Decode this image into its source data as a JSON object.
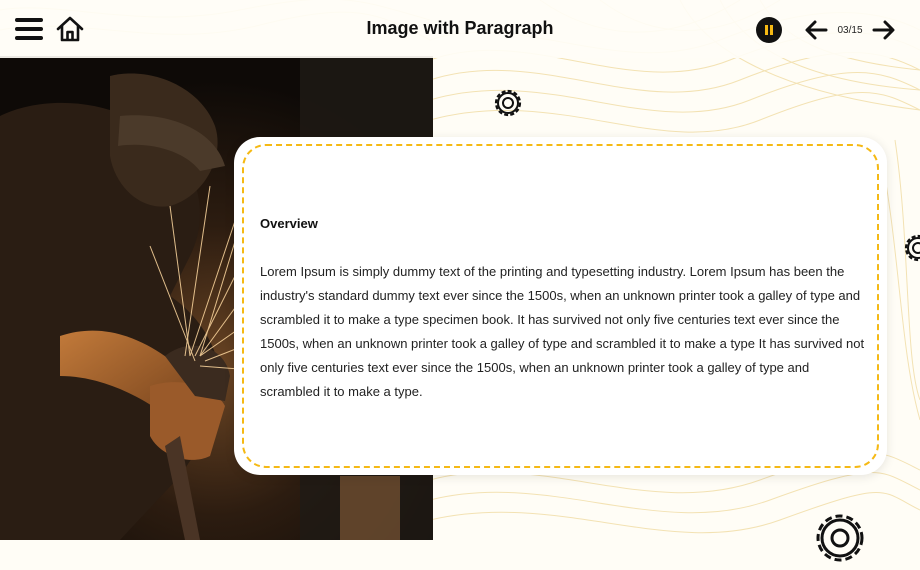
{
  "header": {
    "title": "Image with Paragraph",
    "page_counter": "03/15",
    "icons": {
      "menu": "hamburger-menu-icon",
      "home": "home-icon",
      "pause": "pause-icon",
      "prev": "arrow-left-icon",
      "next": "arrow-right-icon"
    }
  },
  "image": {
    "description_icon": "photo-welder-grinding-sparks"
  },
  "card": {
    "heading": "Overview",
    "paragraph": "Lorem Ipsum is simply dummy text of the printing and typesetting industry. Lorem Ipsum has been the industry's standard dummy text ever since the 1500s, when an unknown printer took a galley of type and scrambled it to make a type specimen book. It has survived not only five centuries text ever since the 1500s, when an unknown printer took a galley of type and scrambled it to make a type It has survived not only five centuries text ever since the 1500s, when an unknown printer took a galley of type and scrambled it to make a type."
  },
  "colors": {
    "accent": "#f5b914",
    "text": "#111111",
    "background": "#fffdf6"
  }
}
